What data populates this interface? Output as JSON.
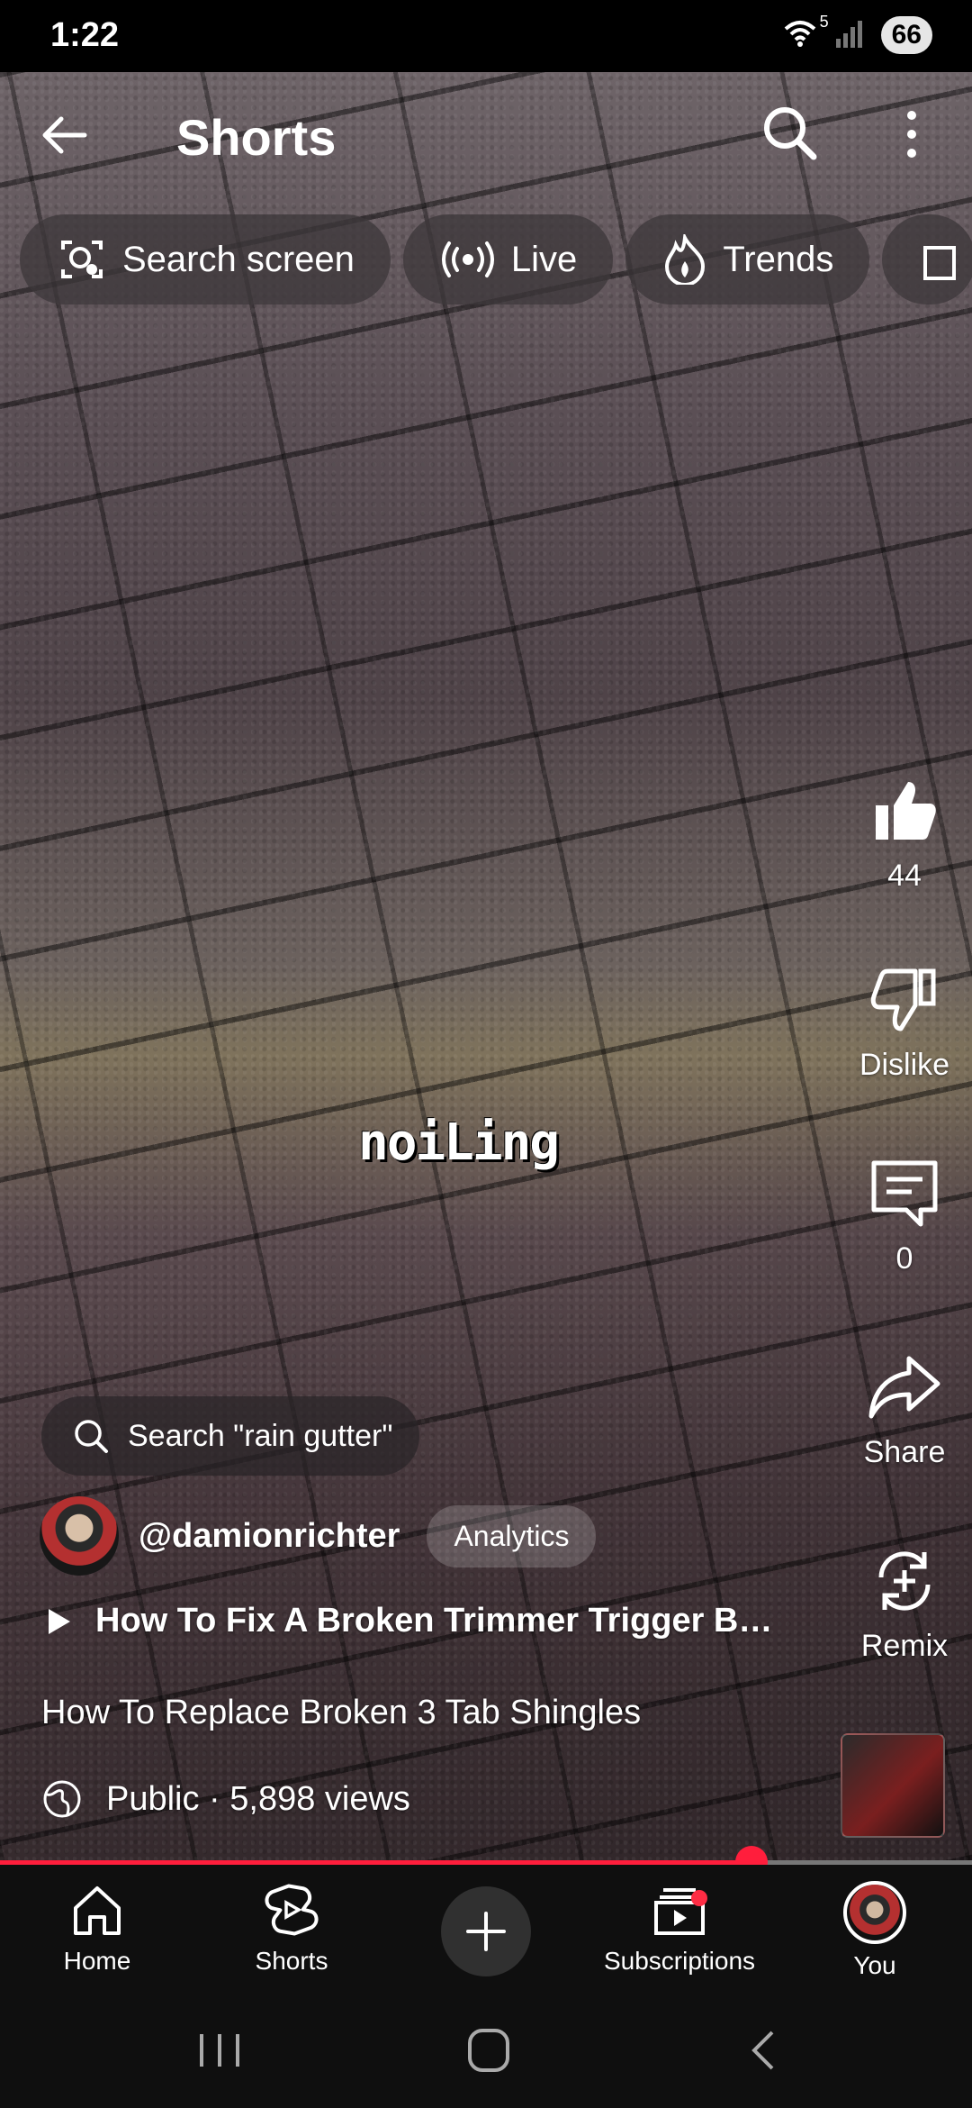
{
  "status_bar": {
    "time": "1:22",
    "wifi_label": "5",
    "battery": "66"
  },
  "header": {
    "title": "Shorts"
  },
  "chips": [
    {
      "label": "Search screen",
      "icon": "search-screen-icon"
    },
    {
      "label": "Live",
      "icon": "live-icon"
    },
    {
      "label": "Trends",
      "icon": "trends-icon"
    }
  ],
  "video": {
    "caption_overlay": "noiLing",
    "search_suggestion": "Search \"rain gutter\"",
    "channel_handle": "@damionrichter",
    "analytics_label": "Analytics",
    "related_title": "How To Fix A Broken Trimmer Trigger Bol...",
    "description": "How To Replace Broken 3 Tab Shingles",
    "meta": "Public · 5,898 views",
    "progress": 0.773
  },
  "actions": {
    "like_count": "44",
    "dislike_label": "Dislike",
    "comment_count": "0",
    "share_label": "Share",
    "remix_label": "Remix"
  },
  "bottom_nav": {
    "home": "Home",
    "shorts": "Shorts",
    "subscriptions": "Subscriptions",
    "you": "You"
  },
  "colors": {
    "accent": "#ff1e3c",
    "nav_bg": "#0f0f0f"
  }
}
